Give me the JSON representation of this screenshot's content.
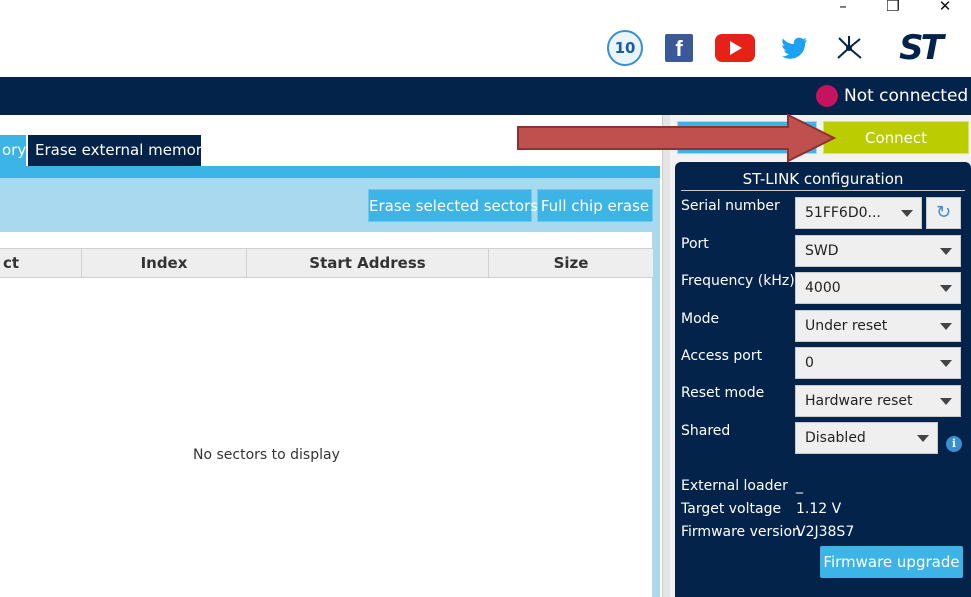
{
  "window": {
    "minimize_glyph": "–",
    "restore_glyph": "❐",
    "close_glyph": "✕"
  },
  "header": {
    "anniversary_badge": "10",
    "facebook_glyph": "f",
    "twitter_glyph": "🐦",
    "brand_logo": "ST",
    "status_text": "Not connected",
    "status_color": "#c6135f"
  },
  "tabs": {
    "left_tab_label": "ory",
    "erase_tab_label": "Erase external memory"
  },
  "toolbar": {
    "erase_selected_label": "Erase selected sectors",
    "full_chip_erase_label": "Full chip erase"
  },
  "table": {
    "columns": [
      "ct",
      "Index",
      "Start Address",
      "Size"
    ],
    "empty_message": "No sectors to display"
  },
  "right_panel": {
    "connect_label": "Connect",
    "config_title": "ST-LINK configuration",
    "fields": [
      {
        "label": "Serial number",
        "value": "51FF6D0..."
      },
      {
        "label": "Port",
        "value": "SWD"
      },
      {
        "label": "Frequency (kHz)",
        "value": "4000"
      },
      {
        "label": "Mode",
        "value": "Under reset"
      },
      {
        "label": "Access port",
        "value": "0"
      },
      {
        "label": "Reset mode",
        "value": "Hardware reset"
      },
      {
        "label": "Shared",
        "value": "Disabled"
      }
    ],
    "info": [
      {
        "label": "External loader",
        "value": "_"
      },
      {
        "label": "Target voltage",
        "value": "1.12 V"
      },
      {
        "label": "Firmware version",
        "value": "V2J38S7"
      }
    ],
    "firmware_upgrade_label": "Firmware upgrade",
    "refresh_glyph": "↻",
    "info_glyph": "i"
  },
  "colors": {
    "navy": "#03234b",
    "accent_blue": "#3cb4e6",
    "connect_green": "#bbcc00",
    "arrow_red": "#c0504d"
  }
}
